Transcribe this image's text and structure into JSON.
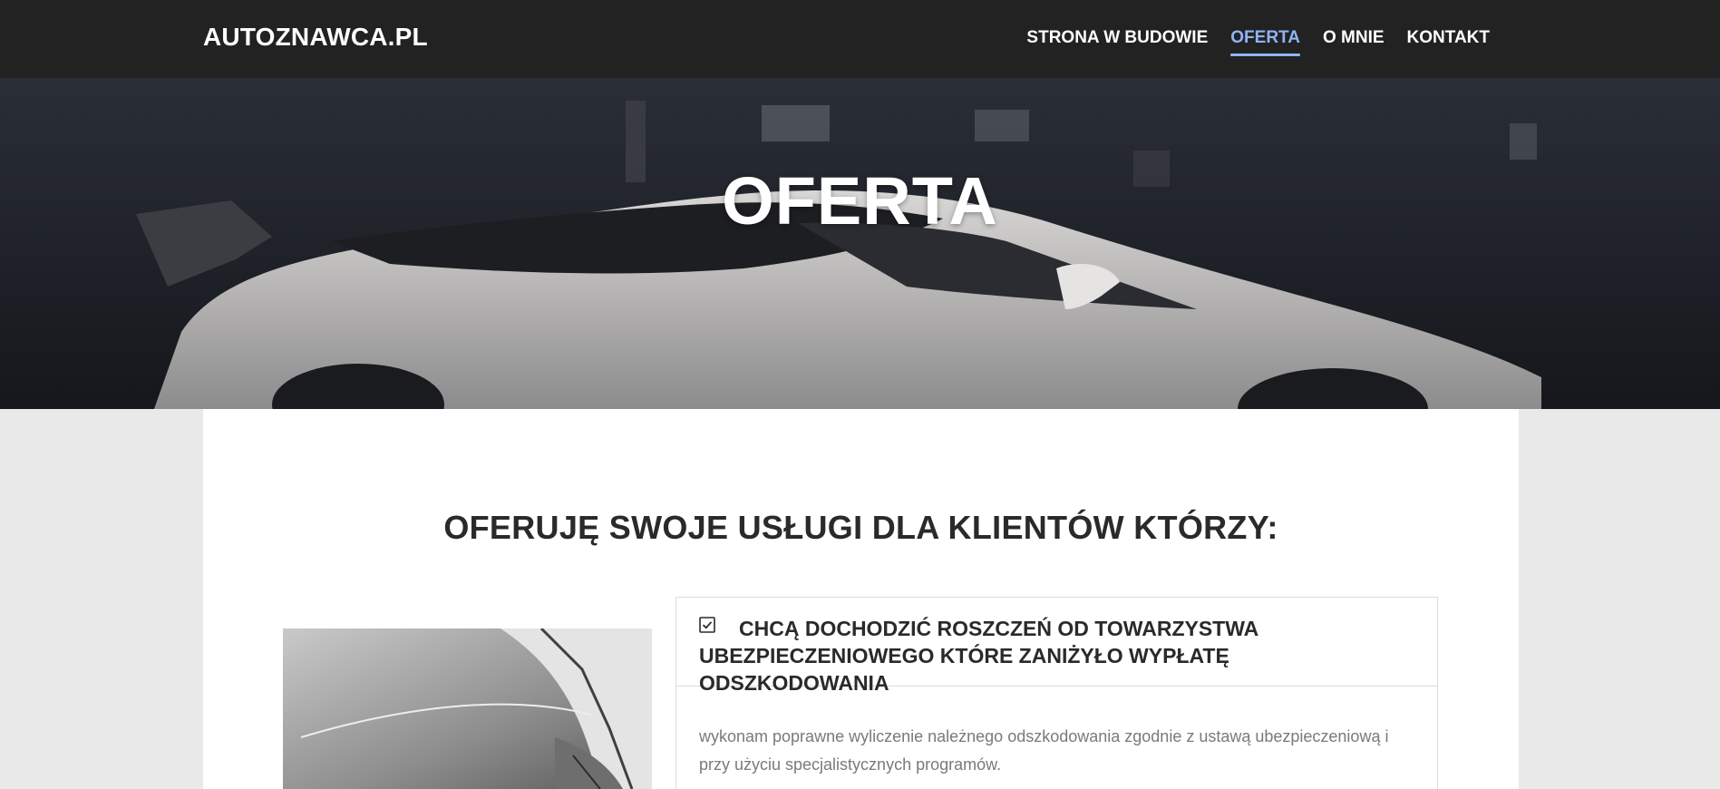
{
  "header": {
    "brand": "AUTOZNAWCA.PL",
    "nav": [
      {
        "label": "STRONA W BUDOWIE",
        "active": false
      },
      {
        "label": "OFERTA",
        "active": true
      },
      {
        "label": "O MNIE",
        "active": false
      },
      {
        "label": "KONTAKT",
        "active": false
      }
    ],
    "accent_color": "#8fb4f2"
  },
  "hero": {
    "title": "OFERTA"
  },
  "main": {
    "heading": "OFERUJĘ SWOJE USŁUGI DLA KLIENTÓW KTÓRZY:",
    "card": {
      "icon": "checkbox-checked-icon",
      "title": "CHCĄ DOCHODZIĆ ROSZCZEŃ OD TOWARZYSTWA UBEZPIECZENIOWEGO KTÓRE ZANIŻYŁO WYPŁATĘ ODSZKODOWANIA",
      "body": "wykonam poprawne wyliczenie należnego odszkodowania zgodnie z ustawą ubezpieczeniową i przy użyciu specjalistycznych programów."
    }
  }
}
